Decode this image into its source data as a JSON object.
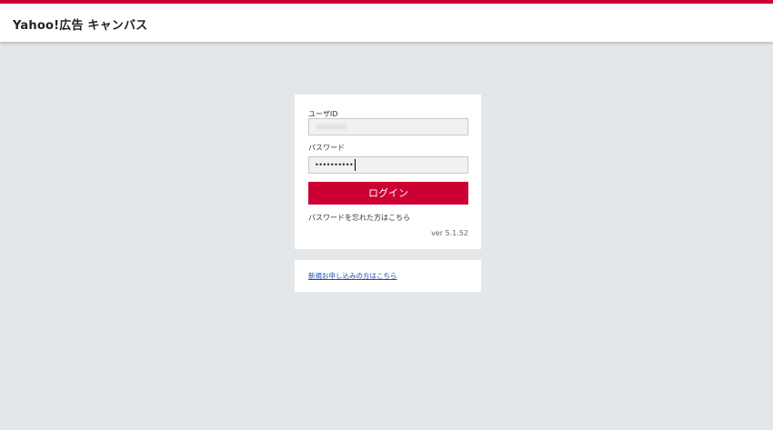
{
  "header": {
    "app_title": "Yahoo!広告 キャンバス"
  },
  "login": {
    "user_id_label": "ユーザID",
    "user_id_value": "xxxxxxx",
    "password_label": "パスワード",
    "password_value": "••••••••••",
    "login_button": "ログイン",
    "forgot_password": "パスワードを忘れた方はこちら",
    "version": "ver 5.1.52"
  },
  "signup": {
    "link": "新規お申し込みの方はこちら"
  },
  "colors": {
    "brand": "#cc0033",
    "background": "#e3e7e9",
    "link": "#1a4fa8"
  }
}
